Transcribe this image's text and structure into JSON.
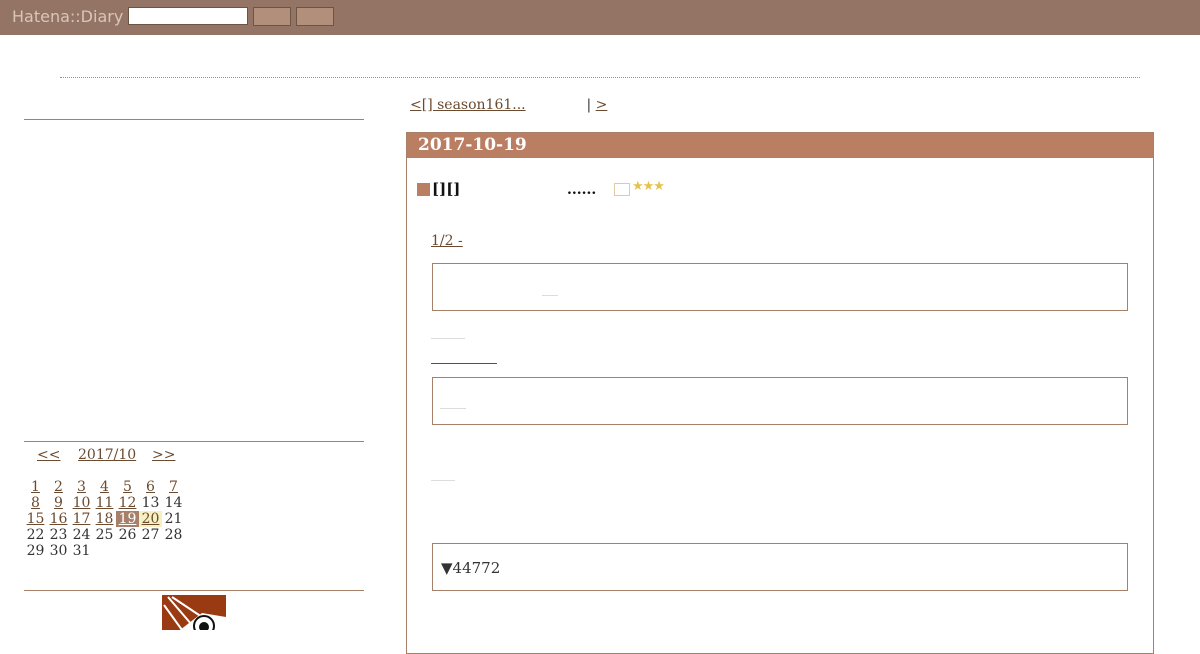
{
  "header": {
    "logo": "Hatena::Diary"
  },
  "pager": {
    "prev": "<[] season161...",
    "sep": "|",
    "next": ">"
  },
  "entry": {
    "date": "2017-10-19",
    "section_title": "[][]",
    "dots": "......",
    "stars_display": "★★★",
    "link_text": "1/2 -",
    "count_text": "▼44772"
  },
  "calendar": {
    "prev": "<<",
    "month": "2017/10",
    "next": ">>",
    "weeks": [
      [
        {
          "d": "1",
          "link": true
        },
        {
          "d": "2",
          "link": true
        },
        {
          "d": "3",
          "link": true
        },
        {
          "d": "4",
          "link": true
        },
        {
          "d": "5",
          "link": true
        },
        {
          "d": "6",
          "link": true
        },
        {
          "d": "7",
          "link": true
        }
      ],
      [
        {
          "d": "8",
          "link": true
        },
        {
          "d": "9",
          "link": true
        },
        {
          "d": "10",
          "link": true
        },
        {
          "d": "11",
          "link": true
        },
        {
          "d": "12",
          "link": true
        },
        {
          "d": "13",
          "link": false
        },
        {
          "d": "14",
          "link": false
        }
      ],
      [
        {
          "d": "15",
          "link": true
        },
        {
          "d": "16",
          "link": true
        },
        {
          "d": "17",
          "link": true
        },
        {
          "d": "18",
          "link": true
        },
        {
          "d": "19",
          "link": true,
          "today": true
        },
        {
          "d": "20",
          "link": true,
          "next": true
        },
        {
          "d": "21",
          "link": false
        }
      ],
      [
        {
          "d": "22",
          "link": false
        },
        {
          "d": "23",
          "link": false
        },
        {
          "d": "24",
          "link": false
        },
        {
          "d": "25",
          "link": false
        },
        {
          "d": "26",
          "link": false
        },
        {
          "d": "27",
          "link": false
        },
        {
          "d": "28",
          "link": false
        }
      ],
      [
        {
          "d": "29",
          "link": false
        },
        {
          "d": "30",
          "link": false
        },
        {
          "d": "31",
          "link": false
        }
      ]
    ]
  }
}
